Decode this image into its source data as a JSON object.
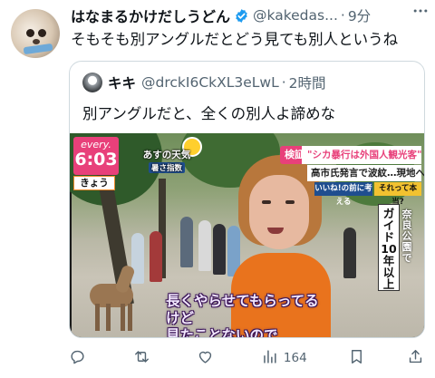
{
  "author": {
    "name": "はなまるかけだしうどん",
    "handle": "@kakedas...",
    "separator": "·",
    "time": "9分",
    "verified": true,
    "avatar_icon": "dog-avatar-icon"
  },
  "menu_icon": "more-icon",
  "tweet_text": "そもそも別アングルだとどう見ても別人というね",
  "quote": {
    "author_name": "キキ",
    "handle": "@drckI6CkXL3eLwL",
    "separator": "·",
    "time": "2時間",
    "text": "別アングルだと、全くの別人よ諦めな",
    "media": {
      "brand": "every.",
      "clock": "6:03",
      "day_label": "きょう",
      "weather_title": "あすの天気",
      "weather_sub": "暑さ指数",
      "kensho": "検証",
      "headline": "\"シカ暴行は外国人観光客\"",
      "headline2": "高市氏発言で波紋…現地へ",
      "tag_left": "いいね!の前に考える",
      "tag_right": "それって本当?",
      "vertical_caption": "奈良公園で",
      "guide_label": "ガイド10年以上",
      "subtitle_line1": "長くやらせてもらってるけど",
      "subtitle_line2": "見たことないので"
    }
  },
  "actions": {
    "reply": {
      "icon": "reply-icon",
      "count": ""
    },
    "repost": {
      "icon": "repost-icon",
      "count": ""
    },
    "like": {
      "icon": "heart-icon",
      "count": ""
    },
    "views": {
      "icon": "views-icon",
      "count": "164"
    },
    "bookmark": {
      "icon": "bookmark-icon",
      "count": ""
    },
    "share": {
      "icon": "share-icon",
      "count": ""
    }
  },
  "colors": {
    "accent": "#1d9bf0",
    "secondary_text": "#536471",
    "border": "#cfd9de",
    "news_pink": "#e8407a",
    "shirt_orange": "#e9731d"
  }
}
